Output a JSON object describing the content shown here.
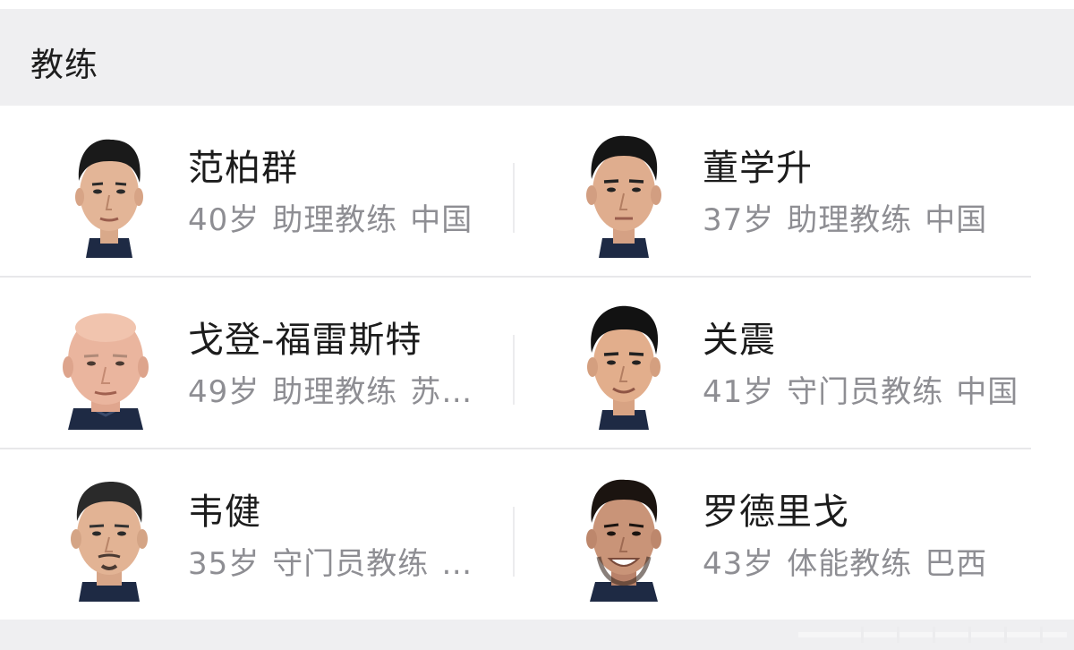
{
  "section": {
    "title": "教练"
  },
  "coaches": [
    {
      "name": "范柏群",
      "age": "40岁",
      "role": "助理教练",
      "nation": "中国",
      "avatar": "bald-false"
    },
    {
      "name": "董学升",
      "age": "37岁",
      "role": "助理教练",
      "nation": "中国",
      "avatar": "dark-hair"
    },
    {
      "name": "戈登-福雷斯特",
      "age": "49岁",
      "role": "助理教练",
      "nation": "苏…",
      "avatar": "bald"
    },
    {
      "name": "关震",
      "age": "41岁",
      "role": "守门员教练",
      "nation": "中国",
      "avatar": "dark-hair"
    },
    {
      "name": "韦健",
      "age": "35岁",
      "role": "守门员教练",
      "nation": "…",
      "avatar": "short-hair"
    },
    {
      "name": "罗德里戈",
      "age": "43岁",
      "role": "体能教练",
      "nation": "巴西",
      "avatar": "smiling"
    }
  ],
  "colors": {
    "header_bg": "#efeff1",
    "name_text": "#1c1c1c",
    "meta_text": "#8e8e93",
    "divider": "#e8e8ea",
    "jersey": "#1e2a44"
  }
}
